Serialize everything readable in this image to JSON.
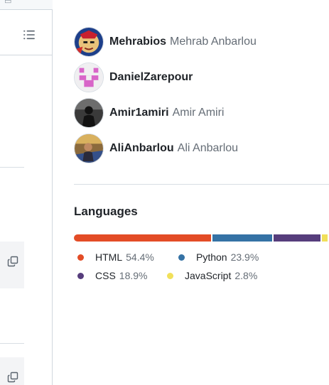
{
  "contributors": [
    {
      "login": "Mehrabios",
      "name": "Mehrab Anbarlou"
    },
    {
      "login": "DanielZarepour",
      "name": ""
    },
    {
      "login": "Amir1amiri",
      "name": "Amir Amiri"
    },
    {
      "login": "AliAnbarlou",
      "name": "Ali Anbarlou"
    }
  ],
  "languages": {
    "title": "Languages",
    "items": [
      {
        "name": "HTML",
        "percent": "54.4%",
        "share": 54.4,
        "color": "#e34c26"
      },
      {
        "name": "Python",
        "percent": "23.9%",
        "share": 23.9,
        "color": "#3572a5"
      },
      {
        "name": "CSS",
        "percent": "18.9%",
        "share": 18.9,
        "color": "#563d7c"
      },
      {
        "name": "JavaScript",
        "percent": "2.8%",
        "share": 2.8,
        "color": "#f1e05a"
      }
    ]
  },
  "icons": {
    "file_tree_toggle": "list-unordered-icon",
    "copy": "copy-icon"
  },
  "colors": {
    "border": "#d0d7de",
    "muted_text": "#656d76",
    "text": "#1f2328"
  }
}
